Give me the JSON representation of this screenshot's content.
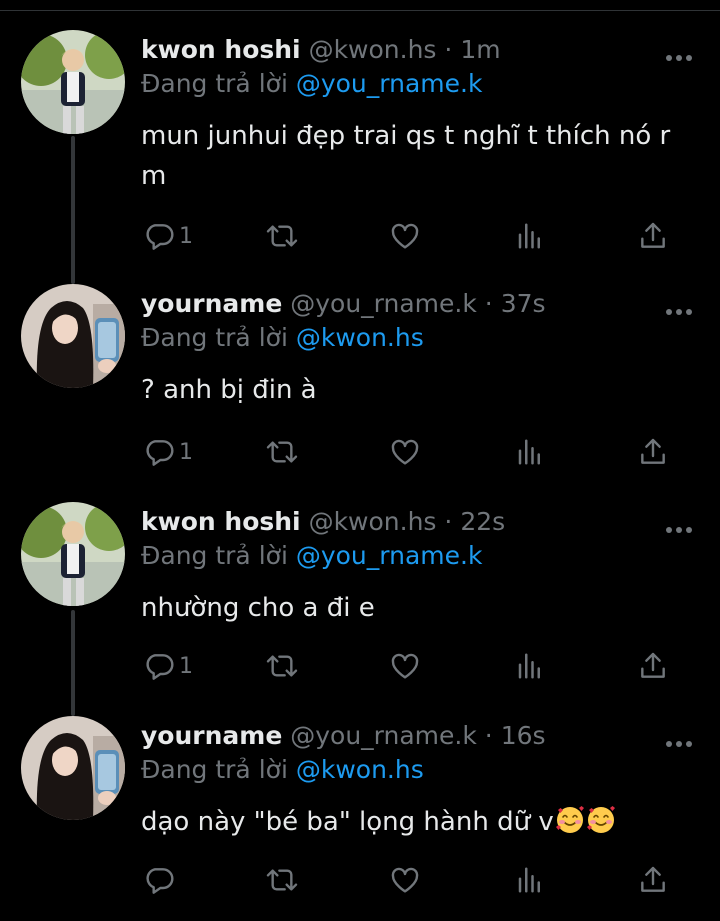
{
  "tweets": [
    {
      "name": "kwon hoshi",
      "handle": "@kwon.hs",
      "separator": "·",
      "time": "1m",
      "reply_label": "Đang trả lời",
      "reply_to": "@you_rname.k",
      "text": "mun junhui đẹp trai qs t nghĩ t thích nó r m",
      "reply_count": "1",
      "avatar": "avatar-kwon-hoshi"
    },
    {
      "name": "yourname",
      "handle": "@you_rname.k",
      "separator": "·",
      "time": "37s",
      "reply_label": "Đang trả lời",
      "reply_to": "@kwon.hs",
      "text": "? anh bị đin à",
      "reply_count": "1",
      "avatar": "avatar-yourname"
    },
    {
      "name": "kwon hoshi",
      "handle": "@kwon.hs",
      "separator": "·",
      "time": "22s",
      "reply_label": "Đang trả lời",
      "reply_to": "@you_rname.k",
      "text": "nhường cho a đi e",
      "reply_count": "1",
      "avatar": "avatar-kwon-hoshi"
    },
    {
      "name": "yourname",
      "handle": "@you_rname.k",
      "separator": "·",
      "time": "16s",
      "reply_label": "Đang trả lời",
      "reply_to": "@kwon.hs",
      "text": "dạo này \"bé ba\" lọng hành dữ v",
      "reply_count": "",
      "avatar": "avatar-yourname",
      "emoji": [
        "smiling-face-with-hearts-emoji",
        "smiling-face-with-hearts-emoji"
      ]
    }
  ],
  "colors": {
    "background": "#000000",
    "text": "#e7e9ea",
    "muted": "#71767b",
    "link": "#1d9bf0",
    "thread_line": "#333639"
  },
  "icons": [
    "more-icon",
    "reply-icon",
    "retweet-icon",
    "like-icon",
    "views-icon",
    "share-icon"
  ]
}
